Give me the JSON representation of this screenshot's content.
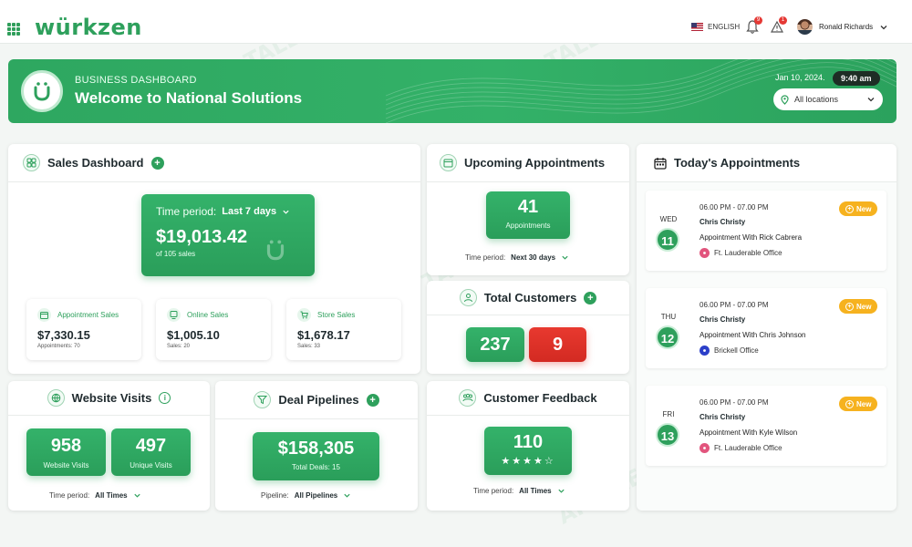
{
  "app": {
    "logo": "würkzen"
  },
  "topbar": {
    "language": "ENGLISH",
    "notifications_count": "9",
    "alerts_count": "1",
    "user_name": "Ronald Richards"
  },
  "banner": {
    "kicker": "BUSINESS DASHBOARD",
    "title": "Welcome to National Solutions",
    "date": "Jan 10, 2024.",
    "time": "9:40 am",
    "location": "All locations"
  },
  "sales": {
    "title": "Sales Dashboard",
    "period_label": "Time period:",
    "period_value": "Last 7 days",
    "total": "$19,013.42",
    "total_sub": "of 105 sales",
    "cards": [
      {
        "label": "Appointment Sales",
        "value": "$7,330.15",
        "sub": "Appointments: 70"
      },
      {
        "label": "Online Sales",
        "value": "$1,005.10",
        "sub": "Sales: 20"
      },
      {
        "label": "Store Sales",
        "value": "$1,678.17",
        "sub": "Sales: 33"
      }
    ]
  },
  "upcoming": {
    "title": "Upcoming Appointments",
    "count": "41",
    "count_label": "Appointments",
    "period_label": "Time period:",
    "period_value": "Next 30 days"
  },
  "customers": {
    "title": "Total Customers",
    "count": "237",
    "new": "9"
  },
  "feedback": {
    "title": "Customer Feedback",
    "count": "110",
    "rating": 4,
    "max": 5,
    "period_label": "Time period:",
    "period_value": "All Times"
  },
  "website": {
    "title": "Website Visits",
    "visits": "958",
    "visits_label": "Website Visits",
    "unique": "497",
    "unique_label": "Unique Visits",
    "period_label": "Time period:",
    "period_value": "All Times"
  },
  "deals": {
    "title": "Deal Pipelines",
    "total": "$158,305",
    "total_label": "Total Deals: 15",
    "pipeline_label": "Pipeline:",
    "pipeline_value": "All Pipelines"
  },
  "today": {
    "title": "Today's Appointments",
    "items": [
      {
        "day": "WED",
        "date": "11",
        "time": "06.00 PM - 07.00 PM",
        "name": "Chris Christy",
        "with": "Appointment With Rick Cabrera",
        "location": "Ft. Lauderable Office",
        "badge": "New",
        "pin_color": "#e2557d"
      },
      {
        "day": "THU",
        "date": "12",
        "time": "06.00 PM - 07.00 PM",
        "name": "Chris Christy",
        "with": "Appointment With Chris Johnson",
        "location": "Brickell Office",
        "badge": "New",
        "pin_color": "#2b3fc9"
      },
      {
        "day": "FRI",
        "date": "13",
        "time": "06.00 PM - 07.00 PM",
        "name": "Chris Christy",
        "with": "Appointment With Kyle Wilson",
        "location": "Ft. Lauderable Office",
        "badge": "New",
        "pin_color": "#e2557d"
      }
    ]
  },
  "colors": {
    "brand": "#2ea05c",
    "alert": "#e8392f",
    "badge": "#f6b21f"
  }
}
